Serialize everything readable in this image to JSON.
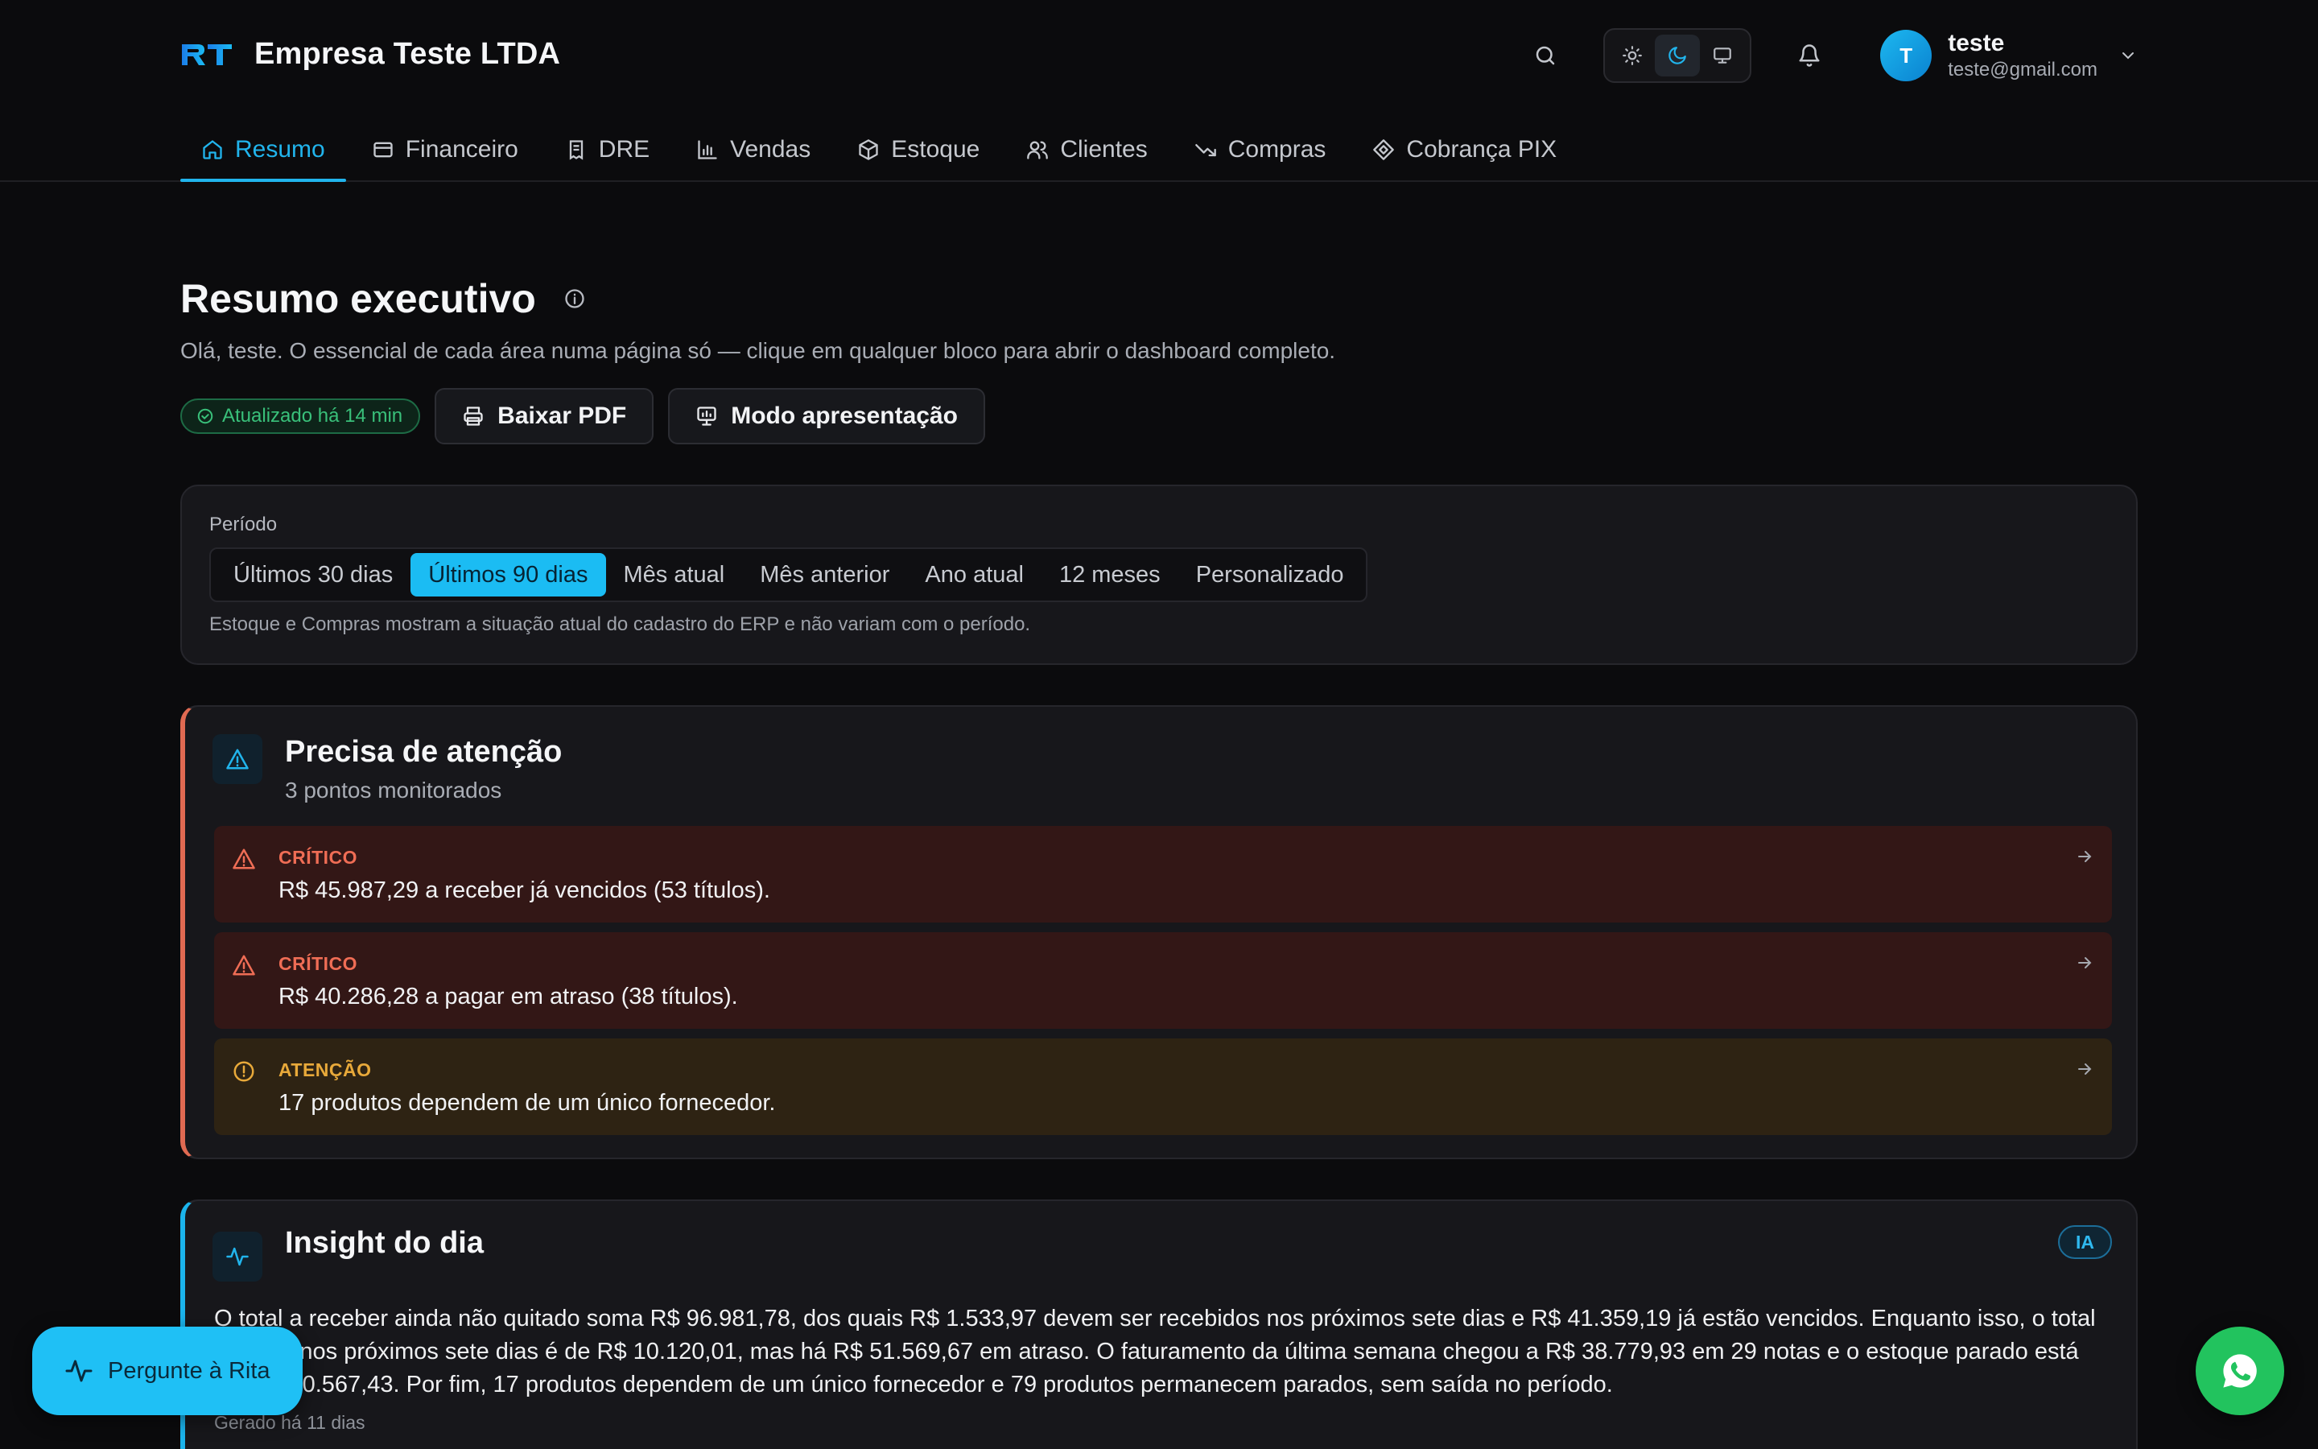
{
  "header": {
    "company": "Empresa Teste LTDA",
    "user": {
      "initial": "T",
      "name": "teste",
      "email": "teste@gmail.com"
    }
  },
  "nav": [
    {
      "label": "Resumo",
      "icon": "home-icon",
      "active": true
    },
    {
      "label": "Financeiro",
      "icon": "wallet-icon"
    },
    {
      "label": "DRE",
      "icon": "receipt-icon"
    },
    {
      "label": "Vendas",
      "icon": "bar-chart-icon"
    },
    {
      "label": "Estoque",
      "icon": "box-icon"
    },
    {
      "label": "Clientes",
      "icon": "users-icon"
    },
    {
      "label": "Compras",
      "icon": "trending-down-icon"
    },
    {
      "label": "Cobrança PIX",
      "icon": "pix-icon"
    }
  ],
  "page": {
    "title": "Resumo executivo",
    "subtitle": "Olá, teste. O essencial de cada área numa página só — clique em qualquer bloco para abrir o dashboard completo.",
    "updated_badge": "Atualizado há 14 min",
    "pdf_button": "Baixar PDF",
    "present_button": "Modo apresentação"
  },
  "period": {
    "label": "Período",
    "options": [
      "Últimos 30 dias",
      "Últimos 90 dias",
      "Mês atual",
      "Mês anterior",
      "Ano atual",
      "12 meses",
      "Personalizado"
    ],
    "selected": "Últimos 90 dias",
    "note": "Estoque e Compras mostram a situação atual do cadastro do ERP e não variam com o período."
  },
  "attention": {
    "title": "Precisa de atenção",
    "subtitle": "3 pontos monitorados",
    "alerts": [
      {
        "level": "CRÍTICO",
        "text": "R$ 45.987,29 a receber já vencidos (53 títulos)."
      },
      {
        "level": "CRÍTICO",
        "text": "R$ 40.286,28 a pagar em atraso (38 títulos)."
      },
      {
        "level": "ATENÇÃO",
        "text": "17 produtos dependem de um único fornecedor."
      }
    ]
  },
  "insight": {
    "title": "Insight do dia",
    "badge": "IA",
    "text": "O total a receber ainda não quitado soma R$ 96.981,78, dos quais R$ 1.533,97 devem ser recebidos nos próximos sete dias e R$ 41.359,19 já estão vencidos. Enquanto isso, o total a pagar nos próximos sete dias é de R$ 10.120,01, mas há R$ 51.569,67 em atraso. O faturamento da última semana chegou a R$ 38.779,93 em 29 notas e o estoque parado está em R$ 40.567,43. Por fim, 17 produtos dependem de um único fornecedor e 79 produtos permanecem parados, sem saída no período.",
    "generated": "Gerado há 11 dias"
  },
  "floating": {
    "rita_label": "Pergunte à Rita"
  },
  "colors": {
    "accent": "#1bbcf3",
    "critical": "#ef6d55",
    "warning": "#e8a93a",
    "success": "#39c07a",
    "whatsapp": "#22c35e"
  }
}
